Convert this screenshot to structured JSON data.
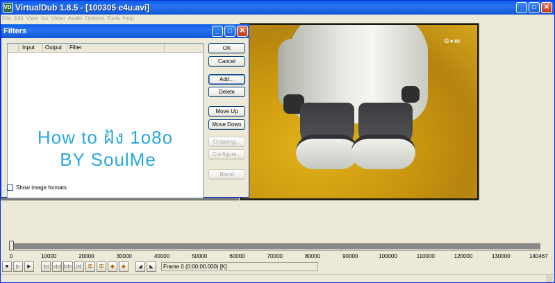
{
  "window": {
    "title": "VirtualDub 1.8.5 - [100305 e4u.avi]",
    "icon": "virtualdub-app-icon",
    "buttons": {
      "minimize": "_",
      "maximize": "□",
      "close": "✕"
    }
  },
  "menu": [
    "File",
    "Edit",
    "View",
    "Go",
    "Video",
    "Audio",
    "Options",
    "Tools",
    "Help"
  ],
  "video": {
    "watermark": "G●m"
  },
  "dialog": {
    "title": "Filters",
    "columns": [
      "",
      "Input",
      "Output",
      "Filter"
    ],
    "overlay_line1": "How to ฝัง 1o8o",
    "overlay_line2": "BY SoulMe",
    "show_formats_label": "Show image formats",
    "show_formats_checked": false,
    "buttons": {
      "ok": "OK",
      "cancel": "Cancel",
      "add": "Add...",
      "delete": "Delete",
      "move_up": "Move Up",
      "move_down": "Move Down",
      "cropping": "Cropping...",
      "configure": "Configure...",
      "blend": "Blend"
    }
  },
  "timeline": {
    "position": 0,
    "ticks": [
      "0",
      "10000",
      "20000",
      "30000",
      "40000",
      "50000",
      "60000",
      "70000",
      "80000",
      "90000",
      "100000",
      "110000",
      "120000",
      "130000",
      "140467"
    ]
  },
  "toolbar": {
    "frame_info": "Frame 0 (0:00:00.000) [K]"
  },
  "colors": {
    "titlebar": "#0A5FE8",
    "overlay_text": "#2AA8E0",
    "video_bg": "#C9960E"
  }
}
